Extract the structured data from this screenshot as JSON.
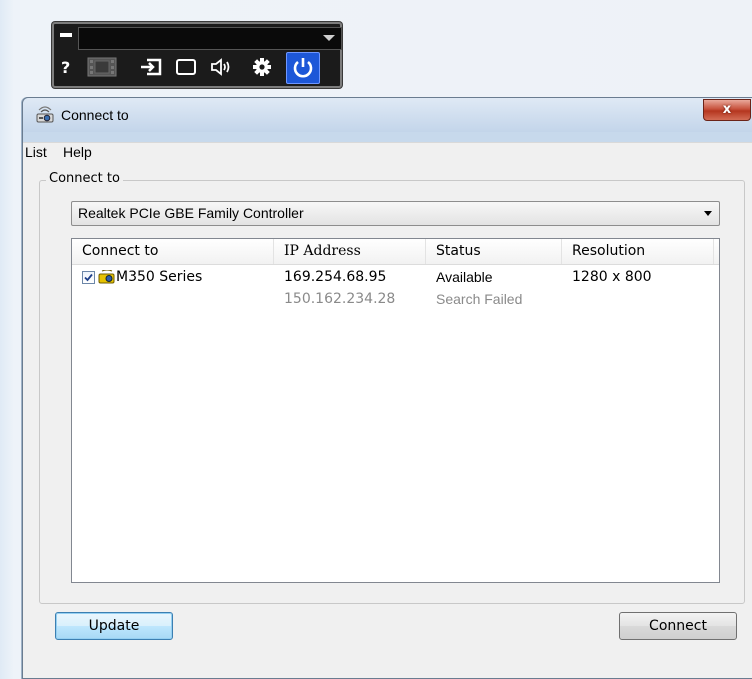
{
  "toolbar": {
    "source_select": {
      "value": ""
    },
    "buttons": [
      {
        "name": "help",
        "icon": "question-mark-icon"
      },
      {
        "name": "video-mute",
        "icon": "film-icon"
      },
      {
        "name": "source",
        "icon": "input-source-icon"
      },
      {
        "name": "blank",
        "icon": "blank-screen-icon"
      },
      {
        "name": "volume",
        "icon": "speaker-icon"
      },
      {
        "name": "settings",
        "icon": "gear-icon"
      },
      {
        "name": "power",
        "icon": "power-icon"
      }
    ],
    "colors": {
      "background": "#1b1b1b",
      "power_accent": "#1d57d8"
    }
  },
  "window": {
    "title": "Connect to",
    "close_label": "x",
    "menu": [
      "List",
      "Help"
    ],
    "group_label": "Connect to",
    "adapter": {
      "selected": "Realtek PCIe GBE Family Controller"
    },
    "list": {
      "columns": [
        "Connect to",
        "IP Address",
        "Status",
        "Resolution"
      ],
      "rows": [
        {
          "checked": true,
          "name": "M350 Series",
          "ip": "169.254.68.95",
          "status": "Available",
          "resolution": "1280 x 800",
          "muted": false
        },
        {
          "checked": false,
          "name": "",
          "ip": "150.162.234.28",
          "status": "Search Failed",
          "resolution": "",
          "muted": true
        }
      ]
    },
    "buttons": {
      "update": "Update",
      "connect": "Connect"
    }
  }
}
